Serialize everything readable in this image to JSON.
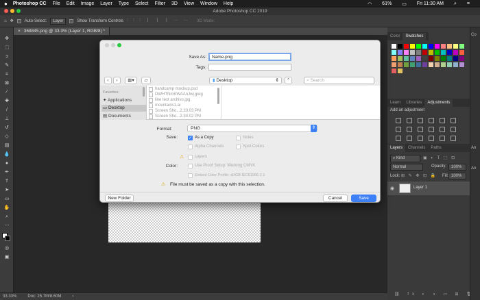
{
  "menubar": {
    "apple": "",
    "app": "Photoshop CC",
    "items": [
      "File",
      "Edit",
      "Image",
      "Layer",
      "Type",
      "Select",
      "Filter",
      "3D",
      "View",
      "Window",
      "Help"
    ],
    "battery": "61%",
    "clock": "Fri 11:30 AM"
  },
  "window": {
    "title": "Adobe Photoshop CC 2019"
  },
  "options": {
    "auto_select": "Auto-Select:",
    "layer_dd": "Layer",
    "transform": "Show Transform Controls",
    "mode3d": "3D Mode:"
  },
  "doc_tab": {
    "label": "368845.png @ 33.3% (Layer 1, RGB/8) *",
    "close": "×"
  },
  "statusbar": {
    "zoom": "33.33%",
    "doc": "Doc: 25.7M/8.60M"
  },
  "dialog": {
    "save_as_label": "Save As:",
    "save_as_value": "Name.png",
    "tags_label": "Tags:",
    "tags_value": "",
    "location": "Desktop",
    "search_placeholder": "Search",
    "sidebar_heading": "Favorites",
    "sidebar_items": [
      "Applications",
      "Desktop",
      "Documents"
    ],
    "files": [
      "handcamp mockup.psd",
      "DWHTNmKWAAnJwj.jpeg",
      "line text archivo.jpg",
      "mountains1.ai",
      "Screen Sho...2.33.03 PM",
      "Screen Sho...2.34.02 PM"
    ],
    "format_label": "Format:",
    "format_value": "PNG",
    "save_label": "Save:",
    "opt_as_copy": "As a Copy",
    "opt_notes": "Notes",
    "opt_alpha": "Alpha Channels",
    "opt_spot": "Spot Colors",
    "opt_layers": "Layers",
    "color_label": "Color:",
    "opt_proof": "Use Proof Setup:  Working CMYK",
    "opt_embed": "Embed Color Profile:  sRGB IEC61966-2.1",
    "warning": "File must be saved as a copy with this selection.",
    "new_folder": "New Folder",
    "cancel": "Cancel",
    "save": "Save"
  },
  "panels": {
    "color_tabs": [
      "Color",
      "Swatches"
    ],
    "adj_tabs": [
      "Learn",
      "Libraries",
      "Adjustments"
    ],
    "adj_hint": "Add an adjustment",
    "layer_tabs": [
      "Layers",
      "Channels",
      "Paths"
    ],
    "kind": "Kind",
    "blend": "Normal",
    "opacity_label": "Opacity:",
    "opacity": "100%",
    "lock_label": "Lock:",
    "fill_label": "Fill:",
    "fill": "100%",
    "layer_name": "Layer 1",
    "side_labels": [
      "Co",
      "An",
      "An"
    ]
  }
}
